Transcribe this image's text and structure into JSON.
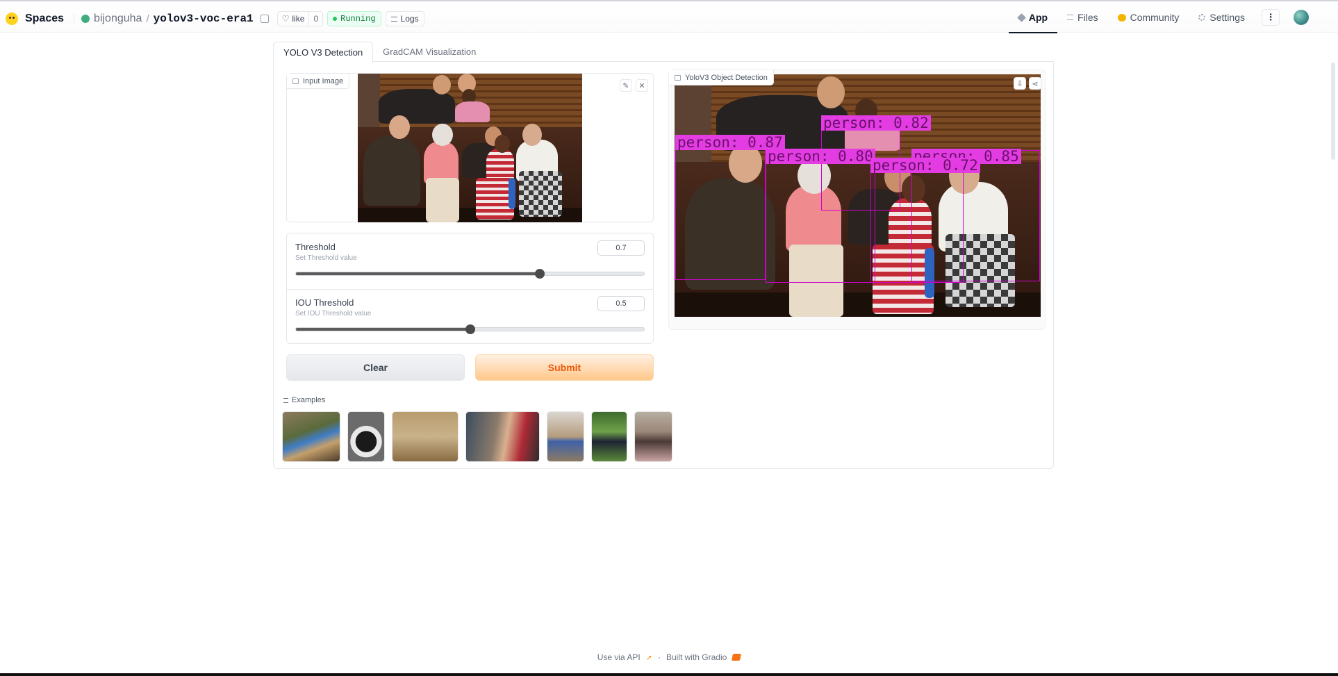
{
  "header": {
    "brand": "Spaces",
    "owner": "bijonguha",
    "repo": "yolov3-voc-era1",
    "like_label": "like",
    "like_count": "0",
    "status": "Running",
    "logs_label": "Logs",
    "nav": [
      {
        "label": "App",
        "icon": "app-icon"
      },
      {
        "label": "Files",
        "icon": "files-icon"
      },
      {
        "label": "Community",
        "icon": "community-icon"
      },
      {
        "label": "Settings",
        "icon": "settings-icon"
      }
    ],
    "more": "⋮"
  },
  "tabs": [
    "YOLO V3 Detection",
    "GradCAM Visualization"
  ],
  "input_image": {
    "label": "Input Image"
  },
  "output_image": {
    "label": "YoloV3 Object Detection"
  },
  "detections": [
    {
      "label": "person: 0.82"
    },
    {
      "label": "person: 0.87"
    },
    {
      "label": "person: 0.80"
    },
    {
      "label": "person: 0.85"
    },
    {
      "label": "person: 0.72"
    }
  ],
  "threshold": {
    "title": "Threshold",
    "info": "Set Threshold value",
    "value": "0.7",
    "fraction": 0.7
  },
  "iou_threshold": {
    "title": "IOU Threshold",
    "info": "Set IOU Threshold value",
    "value": "0.5",
    "fraction": 0.5
  },
  "buttons": {
    "clear": "Clear",
    "submit": "Submit"
  },
  "examples": {
    "label": "Examples"
  },
  "footer": {
    "api": "Use via API",
    "dot": "·",
    "built": "Built with Gradio"
  },
  "colors": {
    "detection": "#e23ce2",
    "submit_text": "#ea580c",
    "running": "#15803d"
  }
}
